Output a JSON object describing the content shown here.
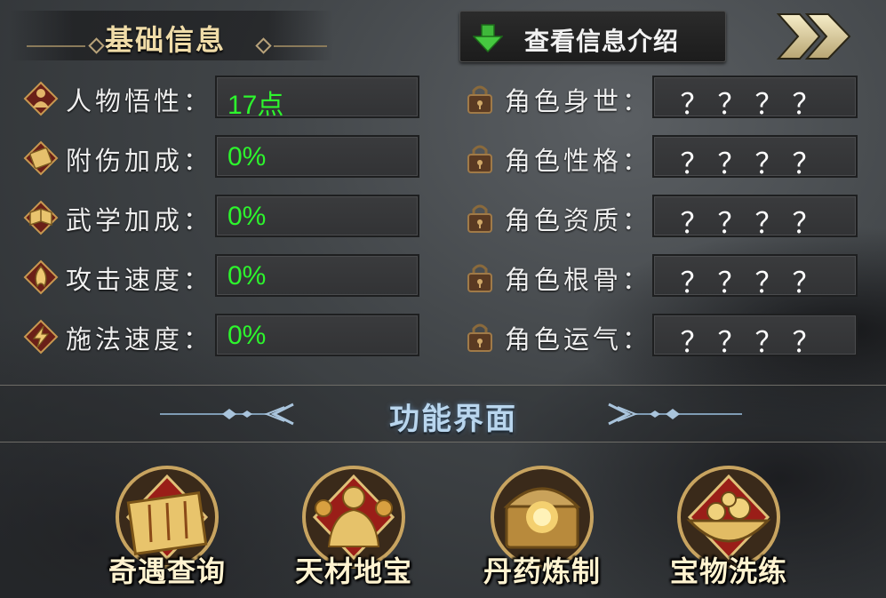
{
  "header": {
    "title": "基础信息",
    "intro_button": "查看信息介绍",
    "next_icon": "double-chevron-right-icon"
  },
  "stats": [
    {
      "icon": "person-icon",
      "label": "人物悟性：",
      "value": "17点"
    },
    {
      "icon": "scroll-icon",
      "label": "附伤加成：",
      "value": "0%"
    },
    {
      "icon": "martial-book-icon",
      "label": "武学加成：",
      "value": "0%"
    },
    {
      "icon": "flame-attack-icon",
      "label": "攻击速度：",
      "value": "0%"
    },
    {
      "icon": "lightning-icon",
      "label": "施法速度：",
      "value": "0%"
    }
  ],
  "traits": [
    {
      "icon": "lock-icon",
      "label": "角色身世：",
      "value": "？？？？"
    },
    {
      "icon": "lock-icon",
      "label": "角色性格：",
      "value": "？？？？"
    },
    {
      "icon": "lock-icon",
      "label": "角色资质：",
      "value": "？？？？"
    },
    {
      "icon": "lock-icon",
      "label": "角色根骨：",
      "value": "？？？？"
    },
    {
      "icon": "lock-icon",
      "label": "角色运气：",
      "value": "？？？？"
    }
  ],
  "functions": {
    "title": "功能界面",
    "buttons": [
      {
        "label": "奇遇查询",
        "icon": "adventure-scroll-icon"
      },
      {
        "label": "天材地宝",
        "icon": "golden-statue-icon"
      },
      {
        "label": "丹药炼制",
        "icon": "alchemy-chest-icon"
      },
      {
        "label": "宝物洗练",
        "icon": "treasure-bowl-icon"
      }
    ]
  },
  "colors": {
    "value_green": "#2df52d",
    "title_gold": "#f0dca8",
    "func_title_blue": "#b9d6ee"
  }
}
